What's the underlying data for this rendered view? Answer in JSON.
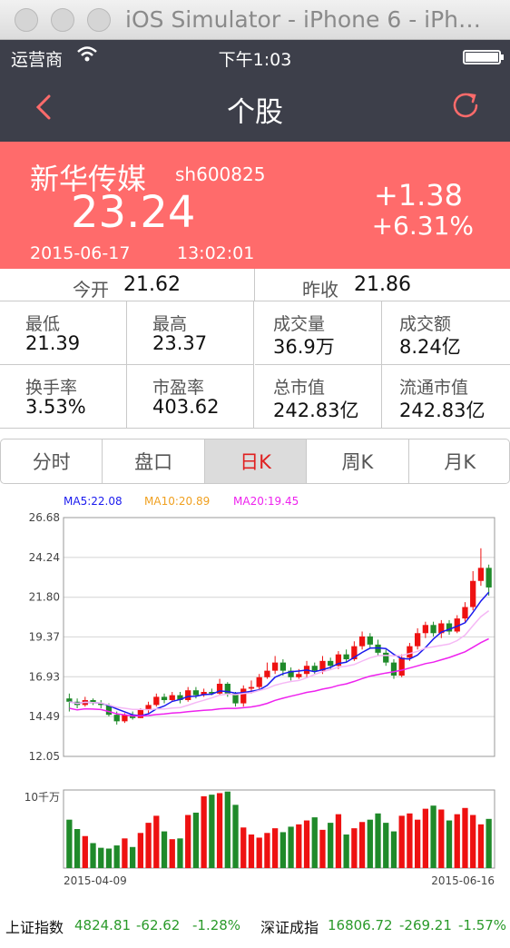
{
  "window": {
    "title": "iOS Simulator - iPhone 6 - iPh…"
  },
  "statusbar": {
    "carrier": "运营商",
    "time": "下午1:03"
  },
  "nav": {
    "title": "个股",
    "back_icon": "chevron-left-icon",
    "refresh_icon": "refresh-icon",
    "accent": "#ff6b6b"
  },
  "quote": {
    "name": "新华传媒",
    "code": "sh600825",
    "price": "23.24",
    "change": "+1.38",
    "change_pct": "+6.31%",
    "date": "2015-06-17",
    "time": "13:02:01",
    "bg": "#ff6b6b"
  },
  "open": {
    "open_label": "今开",
    "open_value": "21.62",
    "prev_label": "昨收",
    "prev_value": "21.86"
  },
  "stats": [
    {
      "label": "最低",
      "value": "21.39"
    },
    {
      "label": "最高",
      "value": "23.37"
    },
    {
      "label": "成交量",
      "value": "36.9万"
    },
    {
      "label": "成交额",
      "value": "8.24亿"
    },
    {
      "label": "换手率",
      "value": "3.53%"
    },
    {
      "label": "市盈率",
      "value": "403.62"
    },
    {
      "label": "总市值",
      "value": "242.83亿"
    },
    {
      "label": "流通市值",
      "value": "242.83亿"
    }
  ],
  "tabs": [
    {
      "label": "分时"
    },
    {
      "label": "盘口"
    },
    {
      "label": "日K"
    },
    {
      "label": "周K"
    },
    {
      "label": "月K"
    }
  ],
  "active_tab": 2,
  "chart_data": {
    "type": "candlestick",
    "ma_labels": [
      {
        "text": "MA5:22.08",
        "color": "#1a1aee"
      },
      {
        "text": "MA10:20.89",
        "color": "#f0a020"
      },
      {
        "text": "MA20:19.45",
        "color": "#ee22ee"
      }
    ],
    "y_ticks": [
      "26.68",
      "24.24",
      "21.80",
      "19.37",
      "16.93",
      "14.49",
      "12.05"
    ],
    "ylim": [
      12.05,
      26.68
    ],
    "x_start": "2015-04-09",
    "x_end": "2015-06-16",
    "volume_label": "10千万",
    "up_color": "#ee1111",
    "down_color": "#1f8a2a",
    "candles": [
      [
        15.6,
        15.4,
        15.9,
        14.8
      ],
      [
        15.4,
        15.2,
        15.6,
        15.0
      ],
      [
        15.2,
        15.5,
        15.7,
        15.1
      ],
      [
        15.5,
        15.3,
        15.6,
        15.2
      ],
      [
        15.3,
        15.2,
        15.5,
        15.0
      ],
      [
        15.2,
        14.6,
        15.3,
        14.5
      ],
      [
        14.6,
        14.2,
        14.8,
        14.0
      ],
      [
        14.2,
        14.6,
        14.7,
        14.1
      ],
      [
        14.6,
        14.4,
        14.8,
        14.3
      ],
      [
        14.4,
        14.9,
        15.0,
        14.4
      ],
      [
        14.9,
        15.2,
        15.4,
        14.7
      ],
      [
        15.2,
        15.7,
        15.9,
        15.1
      ],
      [
        15.7,
        15.5,
        15.9,
        15.3
      ],
      [
        15.5,
        15.8,
        16.0,
        15.4
      ],
      [
        15.8,
        15.5,
        16.0,
        15.3
      ],
      [
        15.5,
        16.1,
        16.3,
        15.4
      ],
      [
        16.1,
        15.8,
        16.3,
        15.6
      ],
      [
        15.8,
        16.0,
        16.2,
        15.7
      ],
      [
        16.0,
        15.9,
        16.2,
        15.8
      ],
      [
        15.9,
        16.5,
        16.8,
        15.8
      ],
      [
        16.5,
        15.9,
        16.6,
        15.7
      ],
      [
        15.9,
        15.3,
        16.0,
        15.1
      ],
      [
        15.3,
        16.2,
        16.4,
        15.1
      ],
      [
        16.2,
        16.3,
        16.7,
        15.9
      ],
      [
        16.3,
        16.9,
        17.1,
        16.1
      ],
      [
        16.9,
        17.3,
        17.8,
        16.8
      ],
      [
        17.3,
        17.8,
        18.2,
        17.1
      ],
      [
        17.8,
        17.3,
        18.0,
        17.0
      ],
      [
        17.3,
        16.9,
        17.5,
        16.7
      ],
      [
        16.9,
        17.1,
        17.4,
        16.8
      ],
      [
        17.1,
        17.6,
        17.9,
        16.9
      ],
      [
        17.6,
        17.3,
        17.8,
        17.1
      ],
      [
        17.3,
        17.9,
        18.2,
        17.1
      ],
      [
        17.9,
        17.6,
        18.1,
        17.4
      ],
      [
        17.6,
        18.3,
        18.5,
        17.4
      ],
      [
        18.3,
        18.0,
        18.6,
        17.8
      ],
      [
        18.0,
        18.8,
        19.1,
        17.9
      ],
      [
        18.8,
        19.4,
        19.7,
        18.6
      ],
      [
        19.4,
        18.9,
        19.6,
        18.7
      ],
      [
        18.9,
        18.4,
        19.2,
        18.2
      ],
      [
        18.4,
        17.8,
        18.6,
        17.6
      ],
      [
        17.8,
        17.0,
        18.0,
        16.8
      ],
      [
        17.0,
        18.1,
        18.3,
        16.9
      ],
      [
        18.1,
        18.8,
        19.0,
        17.9
      ],
      [
        18.8,
        19.6,
        19.9,
        18.6
      ],
      [
        19.6,
        20.1,
        20.3,
        19.3
      ],
      [
        20.1,
        19.6,
        20.3,
        19.4
      ],
      [
        19.6,
        20.2,
        20.4,
        19.3
      ],
      [
        20.2,
        19.7,
        20.4,
        19.5
      ],
      [
        19.7,
        20.5,
        20.7,
        19.6
      ],
      [
        20.5,
        21.2,
        21.5,
        20.3
      ],
      [
        21.2,
        22.8,
        23.4,
        21.0
      ],
      [
        22.8,
        23.6,
        24.8,
        22.5
      ],
      [
        23.6,
        22.4,
        23.8,
        21.9
      ]
    ],
    "volumes": [
      6.2,
      5.0,
      4.1,
      3.2,
      2.6,
      2.5,
      2.9,
      3.8,
      2.7,
      4.5,
      5.8,
      6.7,
      4.7,
      3.7,
      3.8,
      6.8,
      7.1,
      9.2,
      9.4,
      9.6,
      9.8,
      8.1,
      5.2,
      4.3,
      3.9,
      4.5,
      5.1,
      4.6,
      5.3,
      5.6,
      6.1,
      6.5,
      4.9,
      5.8,
      6.9,
      4.3,
      5.1,
      5.9,
      6.2,
      7.0,
      5.8,
      4.7,
      6.7,
      7.0,
      6.2,
      7.6,
      8.0,
      7.5,
      6.1,
      6.9,
      7.7,
      6.8,
      5.6,
      6.3
    ]
  },
  "ticker": [
    {
      "name": "上证指数",
      "value": "4824.81",
      "change": "-62.62",
      "pct": "-1.28%"
    },
    {
      "name": "深证成指",
      "value": "16806.72",
      "change": "-269.21",
      "pct": "-1.57%"
    }
  ]
}
